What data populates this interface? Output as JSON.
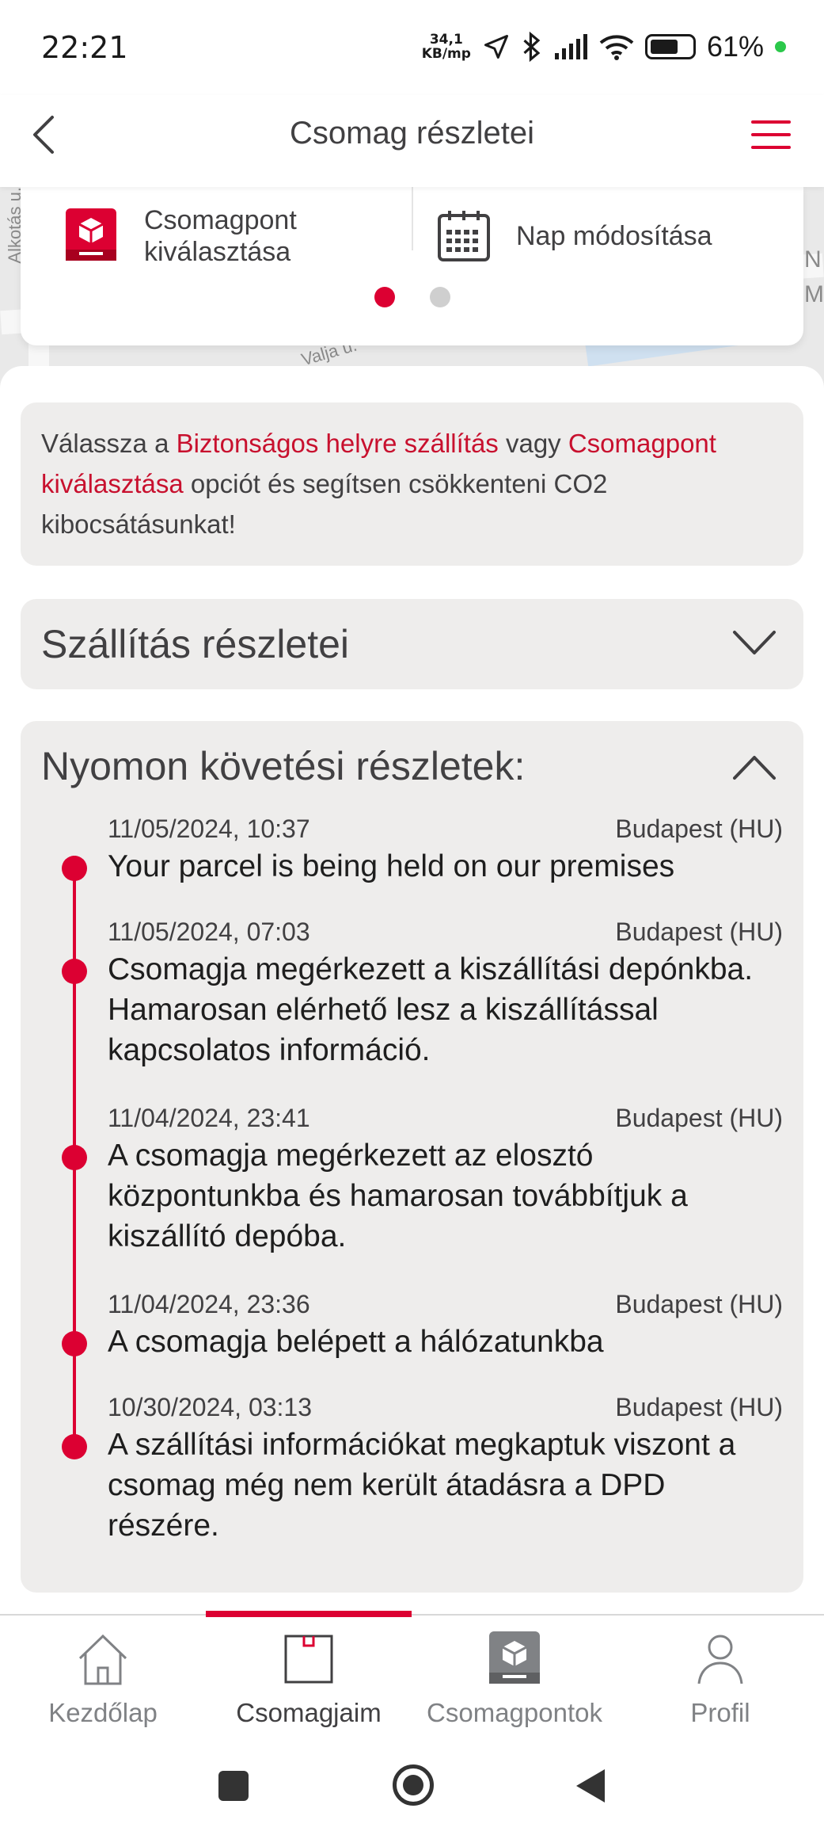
{
  "status_bar": {
    "time": "22:21",
    "speed_value": "34,1",
    "speed_unit": "KB/mp",
    "battery": "61%"
  },
  "header": {
    "title": "Csomag részletei",
    "back_icon": "chevron-left-icon",
    "menu_icon": "hamburger-menu-icon"
  },
  "map": {
    "street_left": "Alkotás u.",
    "street_bottom": "Valja u.",
    "street_right": "N\nM"
  },
  "actions": {
    "items": [
      {
        "label": "Csomagpont\nkiválasztása",
        "icon": "parcel-shop-icon"
      },
      {
        "label": "Nap módosítása",
        "icon": "calendar-icon"
      }
    ],
    "active_page": 1,
    "page_count": 2
  },
  "info_box": {
    "part1": "Válassza a ",
    "highlight1": "Biztonságos helyre szállítás",
    "part2": " vagy ",
    "highlight2": "Csomagpont kiválasztása",
    "part3": " opciót és segítsen csökkenteni CO2 kibocsátásunkat!"
  },
  "shipping_details": {
    "title": "Szállítás részletei",
    "expanded": false
  },
  "tracking": {
    "title": "Nyomon követési részletek:",
    "expanded": true,
    "events": [
      {
        "date": "11/05/2024, 10:37",
        "location": "Budapest (HU)",
        "description": "Your parcel is being held on our premises"
      },
      {
        "date": "11/05/2024, 07:03",
        "location": "Budapest (HU)",
        "description": "Csomagja megérkezett a kiszállítási depónkba. Hamarosan elérhető lesz a kiszállítással kapcsolatos információ."
      },
      {
        "date": "11/04/2024, 23:41",
        "location": "Budapest (HU)",
        "description": "A csomagja megérkezett az elosztó központunkba és hamarosan továbbítjuk a kiszállító depóba."
      },
      {
        "date": "11/04/2024, 23:36",
        "location": "Budapest (HU)",
        "description": "A csomagja belépett a hálózatunkba"
      },
      {
        "date": "10/30/2024, 03:13",
        "location": "Budapest (HU)",
        "description": "A szállítási információkat megkaptuk viszont a csomag még nem került átadásra a DPD részére."
      }
    ]
  },
  "bottom_nav": {
    "items": [
      {
        "label": "Kezdőlap",
        "icon": "home-icon"
      },
      {
        "label": "Csomagjaim",
        "icon": "parcel-box-icon"
      },
      {
        "label": "Csomagpontok",
        "icon": "parcel-shop-icon"
      },
      {
        "label": "Profil",
        "icon": "user-icon"
      }
    ],
    "active": "Csomagjaim"
  },
  "colors": {
    "accent": "#dc0032",
    "text": "#414042",
    "panel": "#eeedec"
  }
}
